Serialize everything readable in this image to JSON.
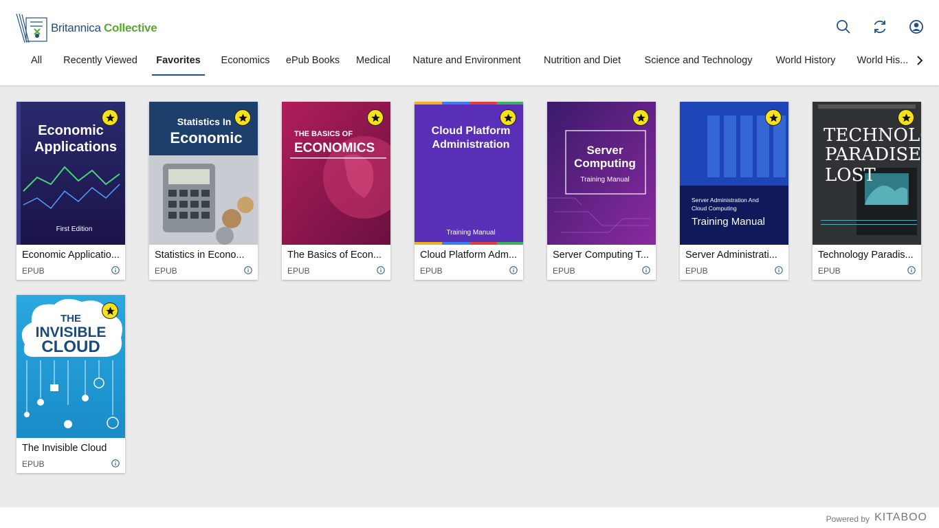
{
  "brand": {
    "part1": "Britannica",
    "part2": "Collective"
  },
  "tabs": [
    {
      "label": "All"
    },
    {
      "label": "Recently Viewed"
    },
    {
      "label": "Favorites"
    },
    {
      "label": "Economics"
    },
    {
      "label": "ePub Books"
    },
    {
      "label": "Medical"
    },
    {
      "label": "Nature and Environment"
    },
    {
      "label": "Nutrition and Diet"
    },
    {
      "label": "Science and Technology"
    },
    {
      "label": "World History"
    },
    {
      "label": "World His..."
    }
  ],
  "active_tab": "Favorites",
  "icons": {
    "search": "search-icon",
    "refresh": "refresh-icon",
    "profile": "user-profile-icon",
    "next": "chevron-right-icon",
    "favorite": "star-icon",
    "info": "info-icon"
  },
  "colors": {
    "brand_blue": "#1f4e86",
    "brand_green": "#5aa832",
    "favorite": "#f7e21a"
  },
  "books": [
    {
      "title": "Economic Applicatio...",
      "format": "EPUB",
      "cover": {
        "line1": "Economic",
        "line2": "Applications",
        "footer": "First Edition"
      }
    },
    {
      "title": "Statistics in Econo...",
      "format": "EPUB",
      "cover": {
        "line1": "Statistics In",
        "line2": "Economic"
      }
    },
    {
      "title": "The Basics of Econ...",
      "format": "EPUB",
      "cover": {
        "line1": "THE BASICS OF",
        "line2": "ECONOMICS"
      }
    },
    {
      "title": "Cloud Platform Adm...",
      "format": "EPUB",
      "cover": {
        "line1": "Cloud Platform",
        "line2": "Administration",
        "footer": "Training Manual"
      }
    },
    {
      "title": "Server Computing T...",
      "format": "EPUB",
      "cover": {
        "line1": "Server",
        "line2": "Computing",
        "footer": "Training Manual"
      }
    },
    {
      "title": "Server Administrati...",
      "format": "EPUB",
      "cover": {
        "line1": "Server Administration And",
        "line2": "Cloud Computing",
        "footer": "Training Manual"
      }
    },
    {
      "title": "Technology Paradis...",
      "format": "EPUB",
      "cover": {
        "line1": "TECHNOLOGY",
        "line2": "PARADISE",
        "line3": "LOST"
      }
    },
    {
      "title": "The Invisible Cloud",
      "format": "EPUB",
      "cover": {
        "line1": "THE",
        "line2": "INVISIBLE",
        "line3": "CLOUD"
      }
    }
  ],
  "footer": {
    "powered_by": "Powered by",
    "vendor": "KITABOO"
  }
}
